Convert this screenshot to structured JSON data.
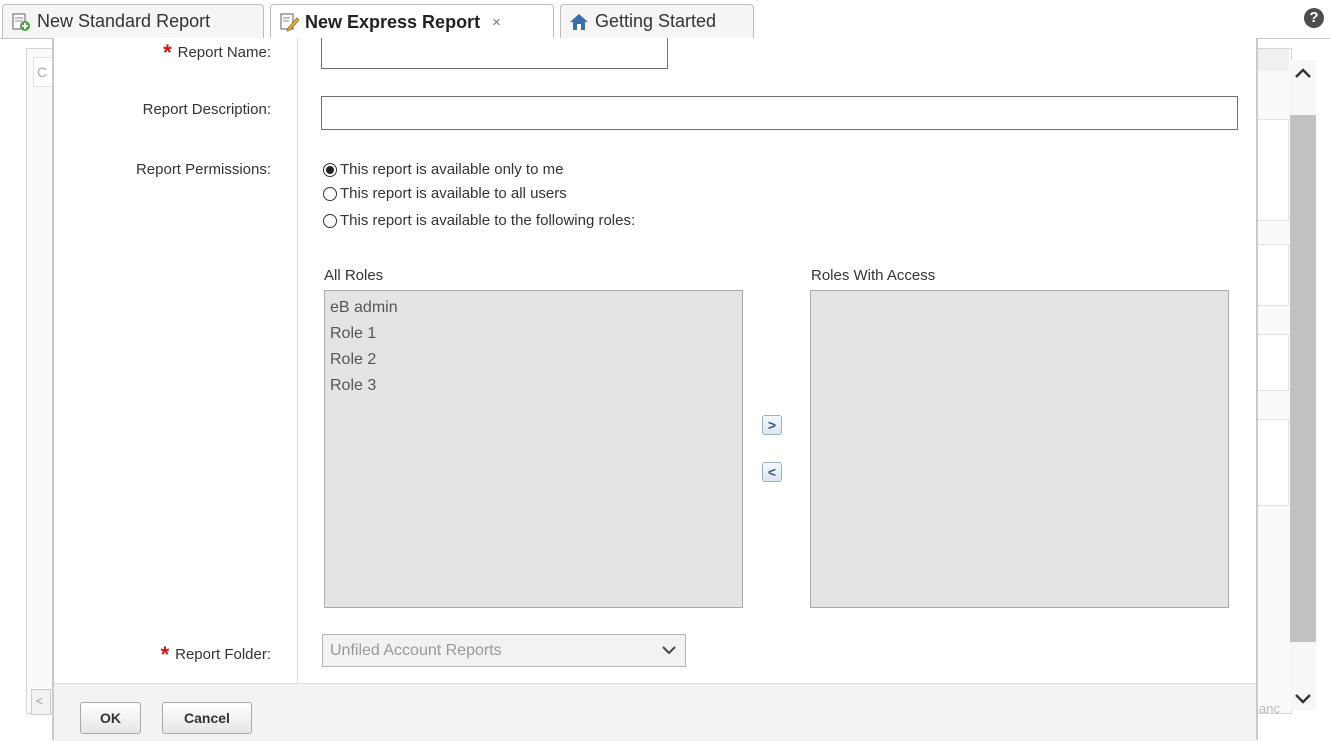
{
  "tabs": [
    {
      "label": "New Standard Report",
      "icon": "report-add-icon",
      "active": false
    },
    {
      "label": "New Express Report",
      "icon": "report-edit-icon",
      "active": true,
      "close": "×"
    },
    {
      "label": "Getting Started",
      "icon": "home-icon",
      "active": false
    }
  ],
  "help_icon": "?",
  "form": {
    "report_name_label": "Report Name:",
    "report_name_value": "",
    "report_description_label": "Report Description:",
    "report_description_value": "",
    "report_permissions_label": "Report Permissions:",
    "permission_options": [
      {
        "label": "This report is available only to me",
        "selected": true
      },
      {
        "label": "This report is available to all users",
        "selected": false
      },
      {
        "label": "This report is available to the following roles:",
        "selected": false
      }
    ],
    "all_roles_label": "All Roles",
    "all_roles": [
      "eB admin",
      "Role 1",
      "Role 2",
      "Role 3"
    ],
    "roles_with_access_label": "Roles With Access",
    "roles_with_access": [],
    "add_arrow": ">",
    "remove_arrow": "<",
    "report_folder_label": "Report Folder:",
    "report_folder_value": "Unfiled Account Reports",
    "required_marker": "*"
  },
  "footer": {
    "ok_label": "OK",
    "cancel_label": "Cancel"
  },
  "background_fragments": {
    "left_letter": "C",
    "right_text": "anc"
  },
  "colors": {
    "required": "#cc1111",
    "disabled_fill": "#e4e4e4",
    "scroll_thumb": "#c1c1c1"
  }
}
